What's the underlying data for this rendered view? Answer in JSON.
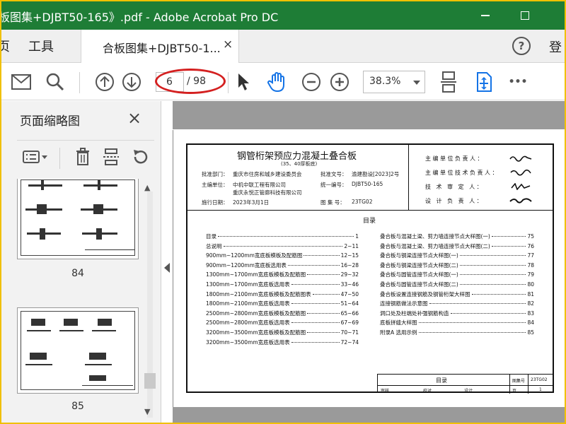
{
  "window": {
    "title": "板图集+DJBT50-165》.pdf - Adobe Acrobat Pro DC"
  },
  "menu": {
    "left_cut": "页",
    "tools": "工具",
    "tab_label": "合板图集+DJBT50-1...",
    "tab_close": "×",
    "login": "登"
  },
  "toolbar": {
    "current_page": "6",
    "page_total": "/ 98",
    "zoom": "38.3%",
    "more": "•••"
  },
  "panel": {
    "title": "页面缩略图",
    "close": "×",
    "thumbs": [
      {
        "label": "84"
      },
      {
        "label": "85"
      }
    ]
  },
  "document": {
    "title": "钢管桁架预应力混凝土叠合板",
    "subtitle": "(35、40厚板底)",
    "meta": {
      "approve_dept_label": "批准部门：",
      "approve_dept": "重庆市住房和城乡建设委员会",
      "approve_doc_label": "批准文号：",
      "approve_doc": "渝建勘设[2023]2号",
      "compile_label": "主编单位：",
      "compile_1": "中机中联工程有限公司",
      "compile_2": "重庆永悦正管廊科技有限公司",
      "unified_label": "统一编号：",
      "unified": "DJBT50-165",
      "date_label": "施行日期：",
      "date": "2023年3月1日",
      "atlas_label": "图 集 号：",
      "atlas": "23TG02"
    },
    "responsibility": [
      "主编单位负责人：",
      "主编单位技术负责人：",
      "技 术 审 定 人：",
      "设 计 负 责 人："
    ],
    "toc_heading": "目录",
    "toc_left": [
      {
        "t": "目录",
        "p": "1"
      },
      {
        "t": "总说明",
        "p": "2~11"
      },
      {
        "t": "900mm~1200mm宽底板模板及配筋图",
        "p": "12~15"
      },
      {
        "t": "900mm~1200mm宽底板选用表",
        "p": "16~28"
      },
      {
        "t": "1300mm~1700mm宽底板模板及配筋图",
        "p": "29~32"
      },
      {
        "t": "1300mm~1700mm宽底板选用表",
        "p": "33~46"
      },
      {
        "t": "1800mm~2100mm宽底板模板及配筋图表",
        "p": "47~50"
      },
      {
        "t": "1800mm~2100mm宽底板选用表",
        "p": "51~64"
      },
      {
        "t": "2500mm~2800mm宽底板模板及配筋图",
        "p": "65~66"
      },
      {
        "t": "2500mm~2800mm宽底板选用表",
        "p": "67~69"
      },
      {
        "t": "3200mm~3500mm宽底板模板及配筋图",
        "p": "70~71"
      },
      {
        "t": "3200mm~3500mm宽底板选用表",
        "p": "72~74"
      }
    ],
    "toc_right": [
      {
        "t": "叠合板与混凝土梁、剪力墙连接节点大样图(一)",
        "p": "75"
      },
      {
        "t": "叠合板与混凝土梁、剪力墙连接节点大样图(二)",
        "p": "76"
      },
      {
        "t": "叠合板与钢梁连接节点大样图(一)",
        "p": "77"
      },
      {
        "t": "叠合板与钢梁连接节点大样图(二)",
        "p": "78"
      },
      {
        "t": "叠合板与圆管连接节点大样图(一)",
        "p": "79"
      },
      {
        "t": "叠合板与圆管连接节点大样图(二)",
        "p": "80"
      },
      {
        "t": "叠合板设置连接钢筋及钢管桁架大样图",
        "p": "81"
      },
      {
        "t": "连接钢筋做法示意图",
        "p": "82"
      },
      {
        "t": "洞口处及柱端处补强钢筋构造",
        "p": "83"
      },
      {
        "t": "底板拼缝大样图",
        "p": "84"
      },
      {
        "t": "附录A 选用示例",
        "p": "85"
      }
    ],
    "titleblock": {
      "name": "目录",
      "atlas_label": "图集号",
      "atlas": "23TG02",
      "row": [
        "审核",
        "校对",
        "设计",
        "页"
      ],
      "page": "1"
    }
  },
  "colors": {
    "titlebar": "#1e7d36",
    "frame": "#f0c000",
    "annotation": "#d42020",
    "accent_blue": "#1473e6"
  },
  "icons": [
    "mail-icon",
    "search-icon",
    "page-up-icon",
    "page-down-icon",
    "select-cursor-icon",
    "hand-tool-icon",
    "zoom-out-icon",
    "zoom-in-icon",
    "fit-page-icon",
    "scroll-mode-icon",
    "more-icon",
    "help-icon",
    "options-icon",
    "delete-icon",
    "extract-icon",
    "rotate-icon"
  ]
}
